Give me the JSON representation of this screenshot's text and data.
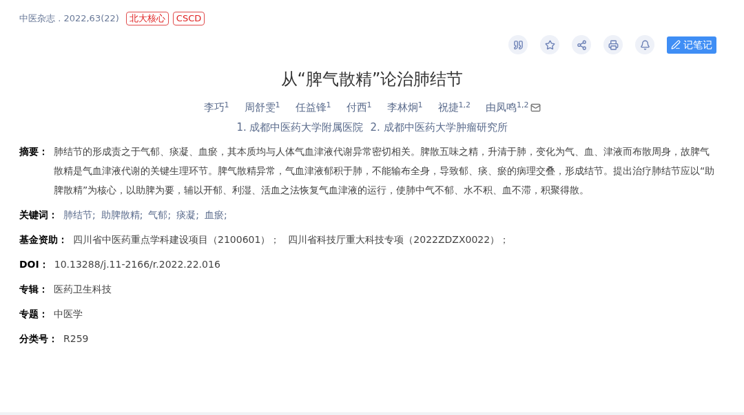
{
  "source": {
    "journal": "中医杂志 . 2022,63(22)",
    "tags": [
      "北大核心",
      "CSCD"
    ]
  },
  "toolbar": {
    "note_button": "记笔记"
  },
  "title": "从“脾气散精”论治肺结节",
  "authors": [
    {
      "name": "李巧",
      "sup": "1",
      "email": false
    },
    {
      "name": "周舒雯",
      "sup": "1",
      "email": false
    },
    {
      "name": "任益锋",
      "sup": "1",
      "email": false
    },
    {
      "name": "付西",
      "sup": "1",
      "email": false
    },
    {
      "name": "李林炯",
      "sup": "1",
      "email": false
    },
    {
      "name": "祝捷",
      "sup": "1,2",
      "email": false
    },
    {
      "name": "由凤鸣",
      "sup": "1,2",
      "email": true
    }
  ],
  "affiliations": [
    "1. 成都中医药大学附属医院",
    "2. 成都中医药大学肿瘤研究所"
  ],
  "fields": [
    {
      "kind": "paragraph",
      "label": "摘要：",
      "value": "肺结节的形成责之于气郁、痰凝、血瘀，其本质均与人体气血津液代谢异常密切相关。脾散五味之精，升清于肺，变化为气、血、津液而布散周身，故脾气散精是气血津液代谢的关键生理环节。脾气散精异常，气血津液郁积于肺，不能输布全身，导致郁、痰、瘀的病理交叠，形成结节。提出治疗肺结节应以“助脾散精”为核心，以助脾为要，辅以开郁、利湿、活血之法恢复气血津液的运行，使肺中气不郁、水不积、血不滞，积聚得散。"
    },
    {
      "kind": "keywords",
      "label": "关键词：",
      "items": [
        "肺结节;",
        "助脾散精;",
        "气郁;",
        "痰凝;",
        "血瘀;"
      ]
    },
    {
      "kind": "funds",
      "label": "基金资助：",
      "items": [
        "四川省中医药重点学科建设项目（2100601）；",
        "四川省科技厅重大科技专项（2022ZDZX0022）；"
      ]
    },
    {
      "kind": "text",
      "label": "DOI：",
      "value": "10.13288/j.11-2166/r.2022.22.016"
    },
    {
      "kind": "text",
      "label": "专辑：",
      "value": "医药卫生科技"
    },
    {
      "kind": "text",
      "label": "专题：",
      "value": "中医学"
    },
    {
      "kind": "text",
      "label": "分类号：",
      "value": "R259"
    }
  ]
}
